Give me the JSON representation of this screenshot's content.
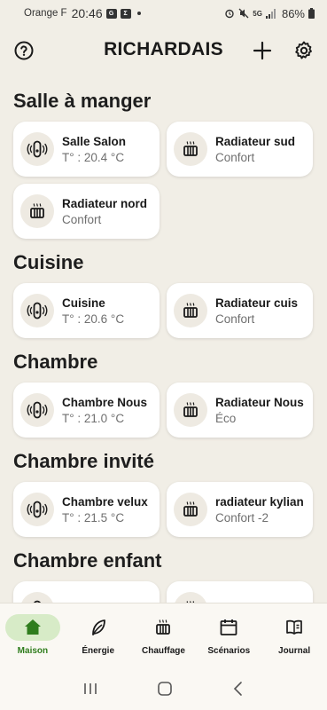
{
  "statusbar": {
    "carrier": "Orange F",
    "time": "20:46",
    "network": "5G",
    "battery": "86%"
  },
  "header": {
    "title": "RICHARDAIS",
    "help_icon": "help-circle-icon",
    "add_icon": "plus-icon",
    "settings_icon": "gear-icon"
  },
  "sections": [
    {
      "title": "Salle à manger",
      "devices": [
        {
          "name": "Salle Salon",
          "value": "T° : 20.4 °C",
          "icon": "thermostat-sensor-icon"
        },
        {
          "name": "Radiateur sud",
          "value": "Confort",
          "icon": "radiator-icon"
        },
        {
          "name": "Radiateur nord",
          "value": "Confort",
          "icon": "radiator-icon"
        }
      ]
    },
    {
      "title": "Cuisine",
      "devices": [
        {
          "name": "Cuisine",
          "value": "T° : 20.6 °C",
          "icon": "thermostat-sensor-icon"
        },
        {
          "name": "Radiateur cuis",
          "value": "Confort",
          "icon": "radiator-icon"
        }
      ]
    },
    {
      "title": "Chambre",
      "devices": [
        {
          "name": "Chambre Nous",
          "value": "T° : 21.0 °C",
          "icon": "thermostat-sensor-icon"
        },
        {
          "name": "Radiateur Nous",
          "value": "Éco",
          "icon": "radiator-icon"
        }
      ]
    },
    {
      "title": "Chambre invité",
      "devices": [
        {
          "name": "Chambre velux",
          "value": "T° : 21.5 °C",
          "icon": "thermostat-sensor-icon"
        },
        {
          "name": "radiateur kylian",
          "value": "Confort -2",
          "icon": "radiator-icon"
        }
      ]
    },
    {
      "title": "Chambre enfant",
      "devices": [
        {
          "name": "",
          "value": "",
          "icon": "thermostat-sensor-icon"
        },
        {
          "name": "",
          "value": "",
          "icon": "radiator-icon"
        }
      ]
    }
  ],
  "bottom_nav": [
    {
      "label": "Maison",
      "icon": "home-icon",
      "active": true
    },
    {
      "label": "Énergie",
      "icon": "leaf-icon",
      "active": false
    },
    {
      "label": "Chauffage",
      "icon": "radiator-icon",
      "active": false
    },
    {
      "label": "Scénarios",
      "icon": "calendar-icon",
      "active": false
    },
    {
      "label": "Journal",
      "icon": "book-icon",
      "active": false
    }
  ],
  "colors": {
    "background": "#f1eee6",
    "card": "#ffffff",
    "accent": "#2f7d1d",
    "accent_bg": "#d7ebc7",
    "subtext": "#6f6f6f"
  }
}
